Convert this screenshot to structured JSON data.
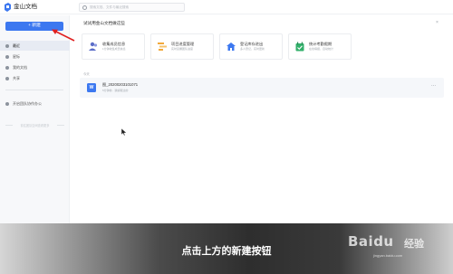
{
  "app": {
    "title": "金山文档"
  },
  "search": {
    "placeholder": "搜索文档、文件与最近搜索"
  },
  "sidebar": {
    "new_button": "+ 新建",
    "items": [
      {
        "label": "最近",
        "active": true
      },
      {
        "label": "星标",
        "active": false
      },
      {
        "label": "我的文档",
        "active": false
      },
      {
        "label": "共享",
        "active": false
      }
    ],
    "team_item": "开启团队协作办公",
    "note": "前往团队空间查看更多"
  },
  "main": {
    "section_title": "试试用金山文档做这些",
    "close": "×",
    "cards": [
      {
        "title": "收集成员信息",
        "subtitle": "1分钟收集成员信息",
        "icon": "people-icon",
        "color": "#5b6dc8"
      },
      {
        "title": "项目进度管理",
        "subtitle": "实时掌握团队进度",
        "icon": "progress-icon",
        "color": "#f2a93b"
      },
      {
        "title": "登记库存进出",
        "subtitle": "多人登记，实时更新",
        "icon": "house-icon",
        "color": "#3c78f0"
      },
      {
        "title": "统计考勤假期",
        "subtitle": "在线填报，自动统计",
        "icon": "calendar-check-icon",
        "color": "#33b06b"
      }
    ],
    "recent_label": "今天",
    "files": [
      {
        "name": "图_20200203101071",
        "meta": "5分钟前 · 我编辑过的",
        "icon": "W",
        "more": "···"
      }
    ]
  },
  "caption": "点击上方的新建按钮",
  "watermark": {
    "brand": "Baidu",
    "cn": "经验",
    "url": "jingyan.baidu.com"
  },
  "colors": {
    "accent": "#3c78f0",
    "annotation": "#e02020"
  }
}
